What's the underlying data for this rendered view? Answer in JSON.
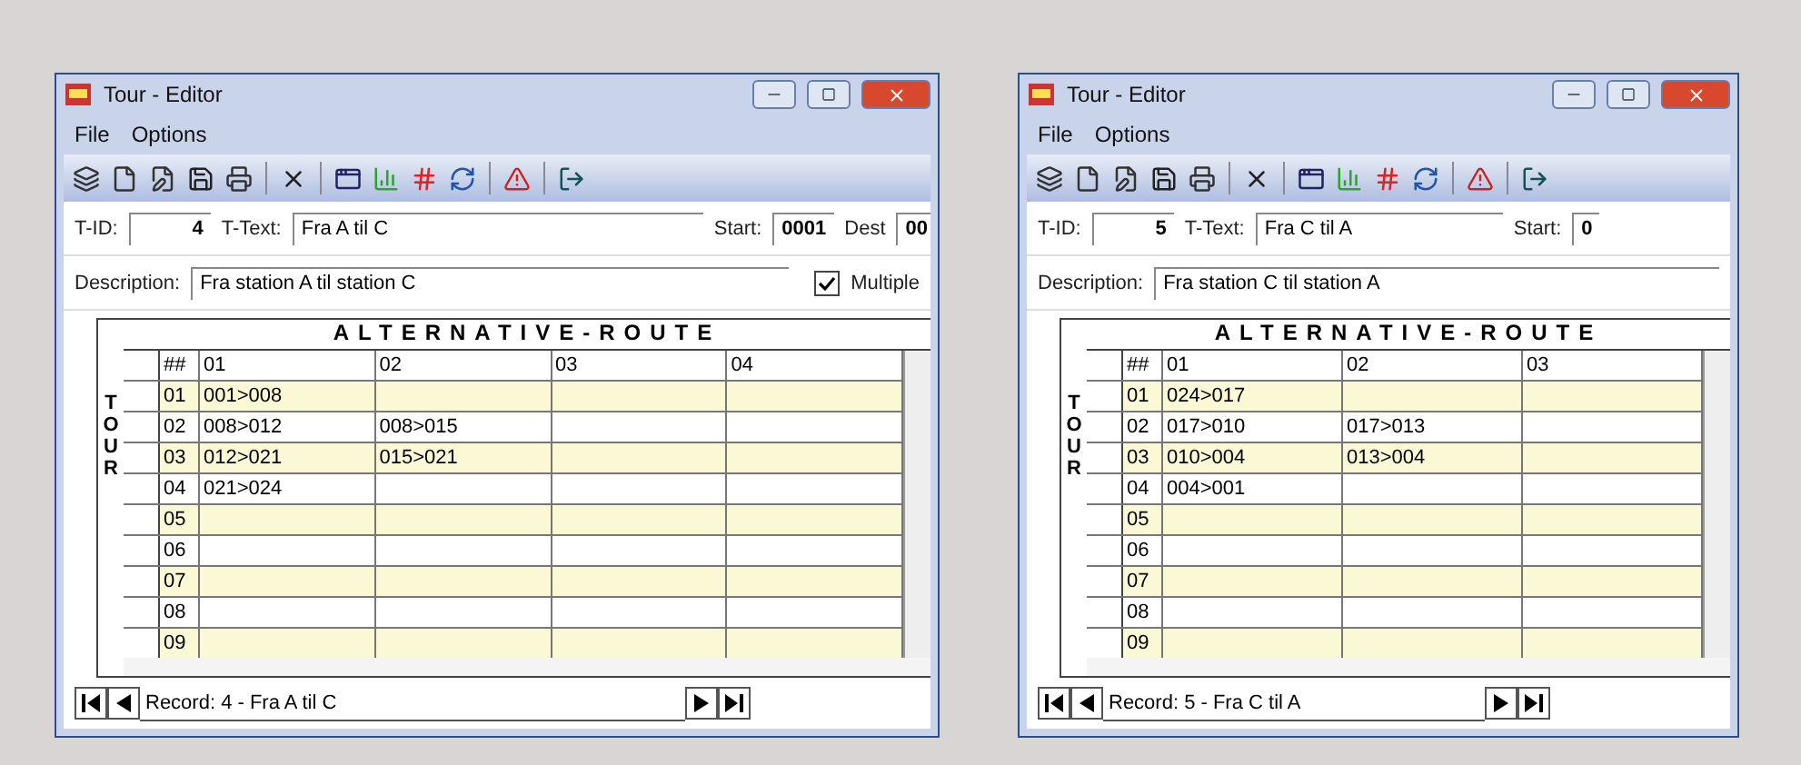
{
  "windows": [
    {
      "title": "Tour - Editor",
      "menu": [
        "File",
        "Options"
      ],
      "tid_label": "T-ID:",
      "tid": "4",
      "ttext_label": "T-Text:",
      "ttext": "Fra A til C",
      "start_label": "Start:",
      "start": "0001",
      "dest_label": "Dest",
      "dest": "00",
      "description_label": "Description:",
      "description": "Fra station A til station C",
      "multiple": {
        "label": "Multiple",
        "checked": true
      },
      "grid": {
        "title": "ALTERNATIVE-ROUTE",
        "side_label": "TOUR",
        "corner": "##",
        "columns": [
          "01",
          "02",
          "03",
          "04"
        ],
        "rows": [
          {
            "num": "01",
            "cells": [
              "001>008"
            ]
          },
          {
            "num": "02",
            "cells": [
              "008>012",
              "008>015"
            ]
          },
          {
            "num": "03",
            "cells": [
              "012>021",
              "015>021"
            ]
          },
          {
            "num": "04",
            "cells": [
              "021>024"
            ]
          },
          {
            "num": "05",
            "cells": []
          },
          {
            "num": "06",
            "cells": []
          },
          {
            "num": "07",
            "cells": []
          },
          {
            "num": "08",
            "cells": []
          },
          {
            "num": "09",
            "cells": []
          }
        ]
      },
      "navigator": "Record: 4 - Fra A til C"
    },
    {
      "title": "Tour - Editor",
      "menu": [
        "File",
        "Options"
      ],
      "tid_label": "T-ID:",
      "tid": "5",
      "ttext_label": "T-Text:",
      "ttext": "Fra C til A",
      "start_label": "Start:",
      "start": "0",
      "description_label": "Description:",
      "description": "Fra station C til station A",
      "grid": {
        "title": "ALTERNATIVE-ROUTE",
        "side_label": "TOUR",
        "corner": "##",
        "columns": [
          "01",
          "02",
          "03"
        ],
        "rows": [
          {
            "num": "01",
            "cells": [
              "024>017"
            ]
          },
          {
            "num": "02",
            "cells": [
              "017>010",
              "017>013"
            ]
          },
          {
            "num": "03",
            "cells": [
              "010>004",
              "013>004"
            ]
          },
          {
            "num": "04",
            "cells": [
              "004>001"
            ]
          },
          {
            "num": "05",
            "cells": []
          },
          {
            "num": "06",
            "cells": []
          },
          {
            "num": "07",
            "cells": []
          },
          {
            "num": "08",
            "cells": []
          },
          {
            "num": "09",
            "cells": []
          }
        ]
      },
      "navigator": "Record: 5 - Fra C til A"
    }
  ]
}
